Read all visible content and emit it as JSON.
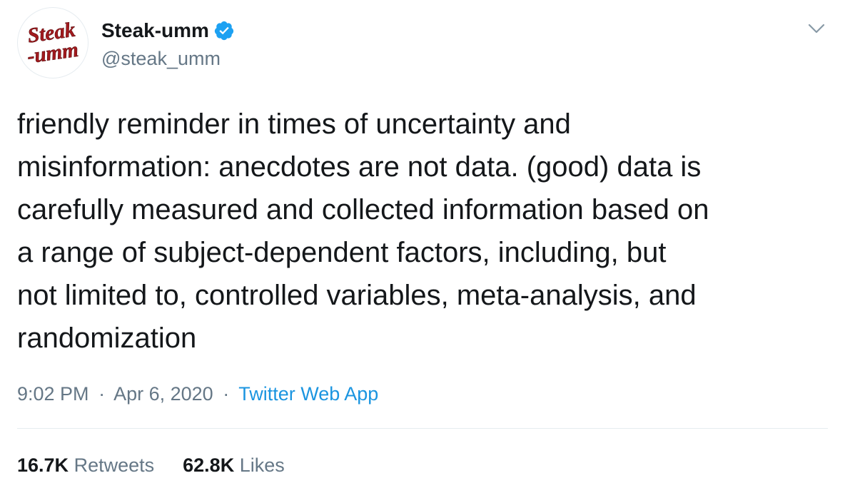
{
  "author": {
    "display_name": "Steak-umm",
    "handle": "@steak_umm",
    "verified": true,
    "avatar_logo_text": [
      "Steak",
      "-umm"
    ]
  },
  "tweet": {
    "text": "friendly reminder in times of uncertainty and\nmisinformation: anecdotes are not data. (good) data is\ncarefully measured and collected information based on\na range of subject-dependent factors, including, but\nnot limited to, controlled variables, meta-analysis, and\nrandomization",
    "time": "9:02 PM",
    "separator": "·",
    "date": "Apr 6, 2020",
    "source": "Twitter Web App"
  },
  "stats": {
    "retweets_count": "16.7K",
    "retweets_label": "Retweets",
    "likes_count": "62.8K",
    "likes_label": "Likes"
  },
  "icons": {
    "verified": "verified-badge-icon",
    "more": "chevron-down-icon"
  },
  "colors": {
    "text": "#14171a",
    "secondary": "#657786",
    "link": "#1b95e0",
    "verified": "#1da1f2",
    "logo_red": "#a31a1e",
    "divider": "#e6ecf0"
  }
}
